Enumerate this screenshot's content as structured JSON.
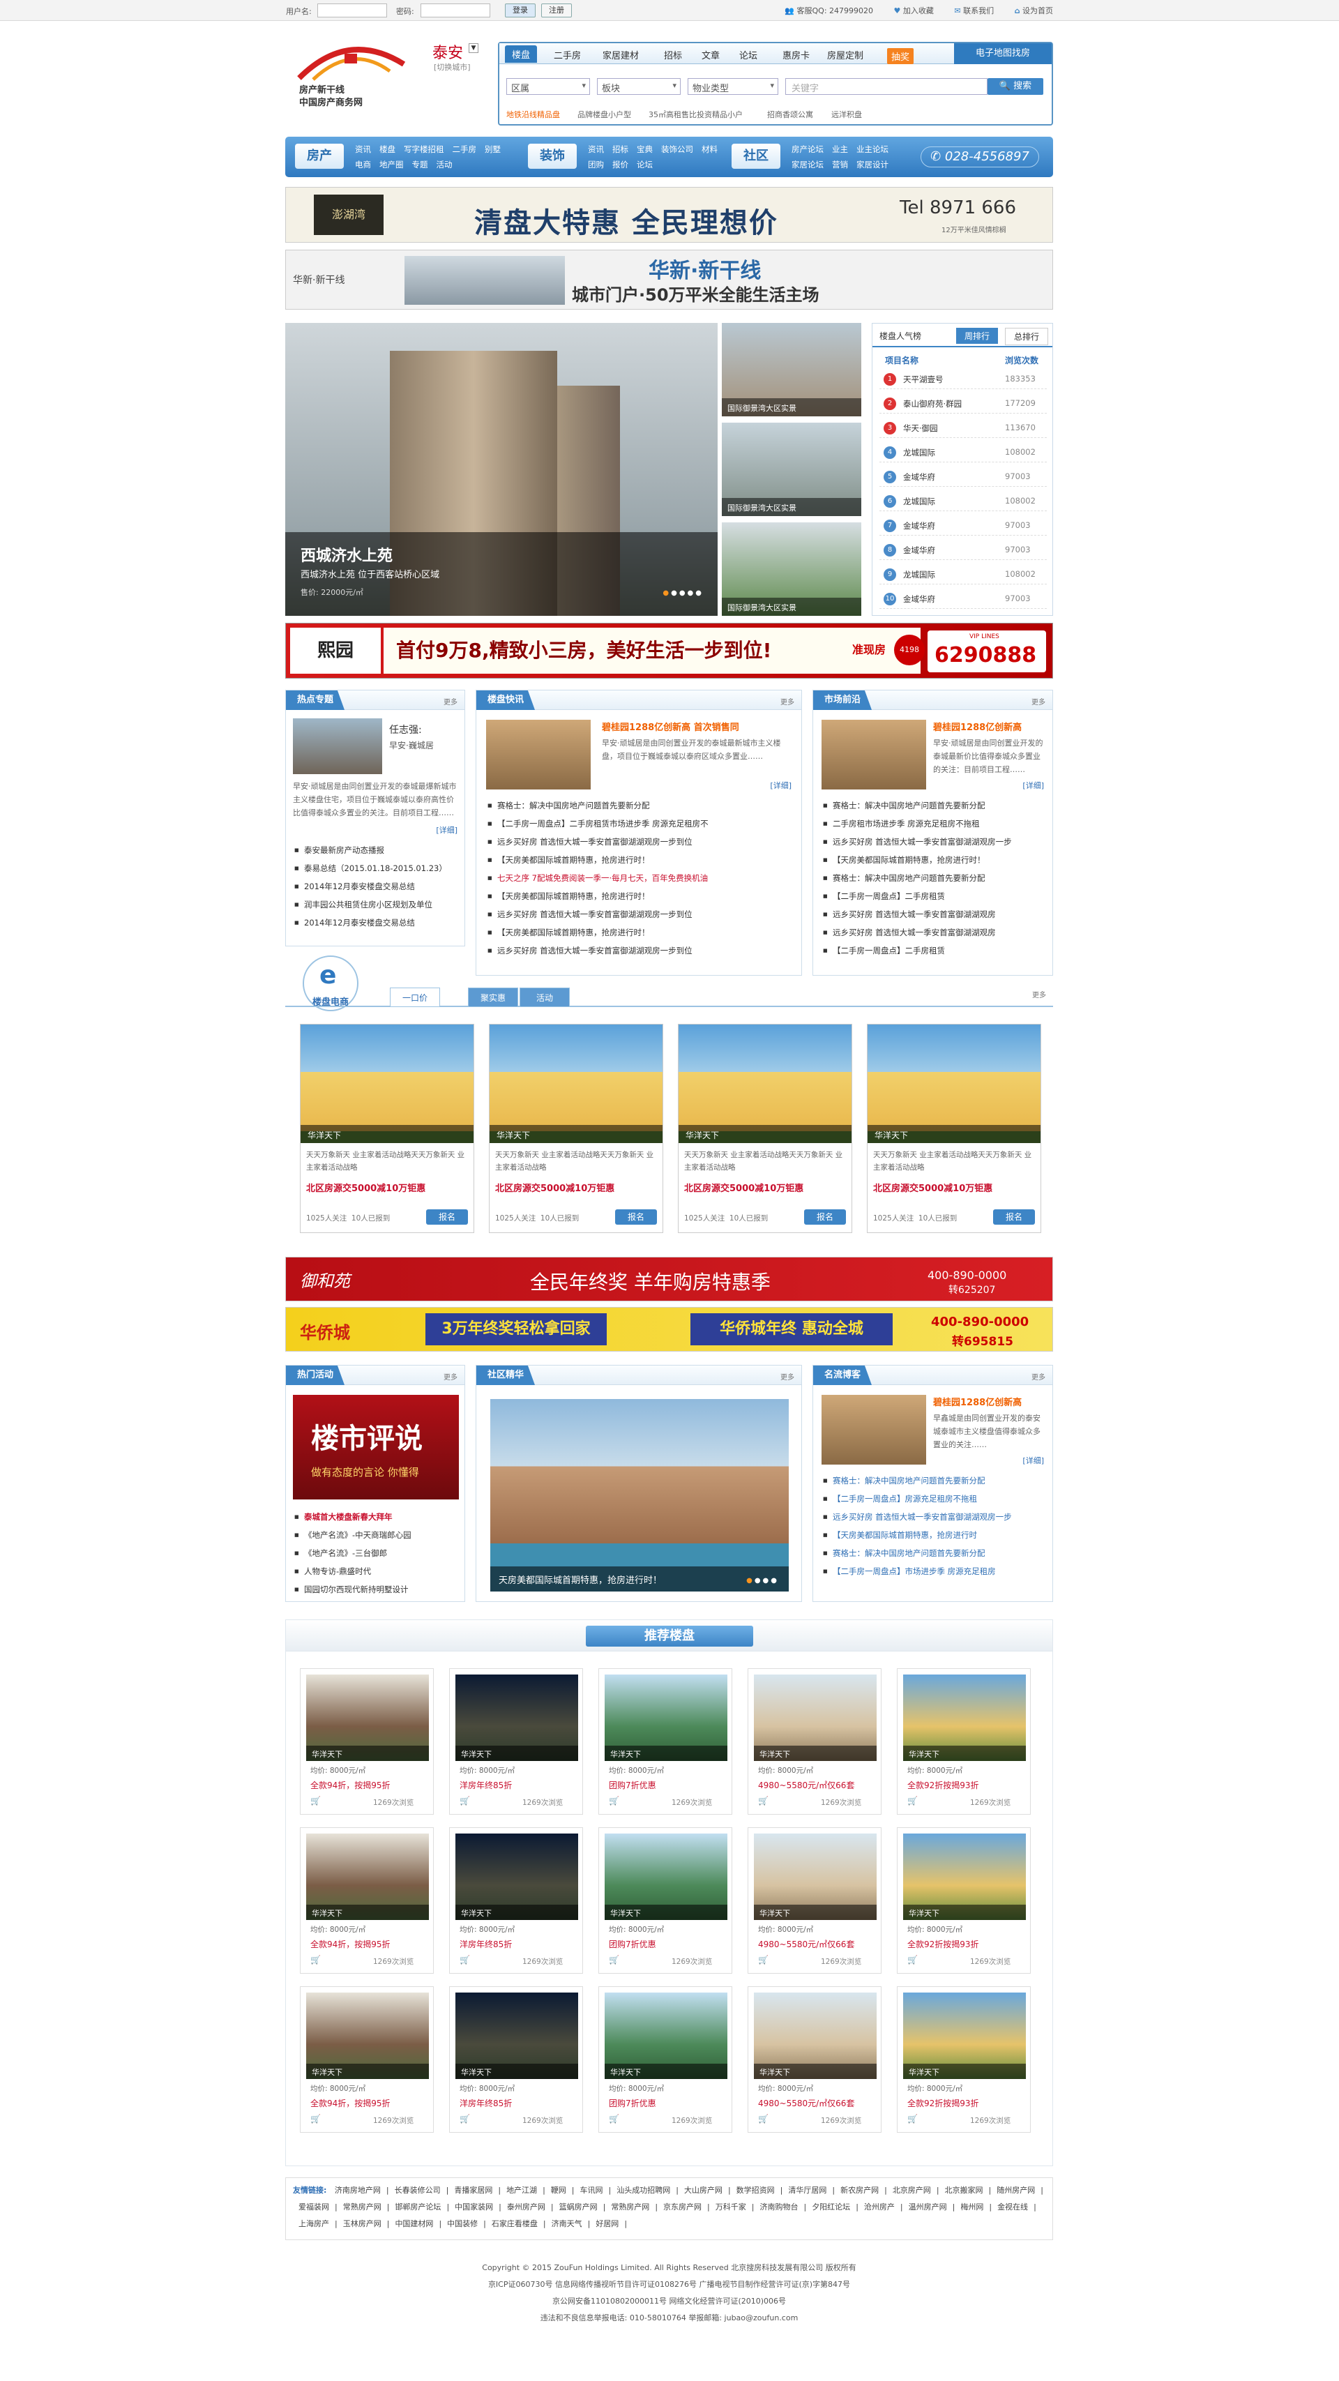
{
  "topbar": {
    "username_label": "用户名:",
    "password_label": "密码:",
    "login": "登录",
    "register": "注册",
    "service": "客服QQ: 247999020",
    "favorite": "加入收藏",
    "contact": "联系我们",
    "homepage": "设为首页"
  },
  "logo": {
    "line1": "房产新干线",
    "line2": "中国房产商务网"
  },
  "city": {
    "name": "泰安",
    "switch": "[切换城市]"
  },
  "search": {
    "tabs": [
      "楼盘",
      "二手房",
      "家居建材",
      "招标",
      "文章",
      "论坛",
      "惠房卡",
      "房屋定制",
      "抽奖"
    ],
    "map_tab": "电子地图找房",
    "selects": [
      "区属",
      "板块",
      "物业类型"
    ],
    "keyword_placeholder": "关键字",
    "button": "搜索",
    "hot": [
      "地铁沿线精品盘",
      "品牌楼盘小户型",
      "35㎡高租售比投资精品小户",
      "招商香颂公寓",
      "远洋积盘"
    ]
  },
  "nav": {
    "groups": [
      {
        "title": "房产",
        "links": [
          "资讯",
          "楼盘",
          "写字楼招租",
          "二手房",
          "别墅",
          "电商",
          "地产圈",
          "专题",
          "活动"
        ]
      },
      {
        "title": "装饰",
        "links": [
          "资讯",
          "招标",
          "宝典",
          "装饰公司",
          "材料",
          "团购",
          "报价",
          "论坛"
        ]
      },
      {
        "title": "社区",
        "links": [
          "房产论坛",
          "业主",
          "业主论坛",
          "家居论坛",
          "营销",
          "家居设计"
        ]
      }
    ],
    "phone": "028-4556897"
  },
  "banners": {
    "b1_brand": "澎湖湾",
    "b1_text": "清盘大特惠  全民理想价",
    "b1_tel": "Tel 8971 666",
    "b1_sub": "12万平米佳风情棕榈",
    "b2_brand": "华新·新干线",
    "b2_title": "华新·新干线",
    "b2_text": "城市门户·50万平米全能生活主场",
    "b3_brand": "熙园",
    "b3_text": "首付9万8,精致小三房，美好生活一步到位!",
    "b3_tag": "准现房",
    "b3_vip": "VIP LINES",
    "b3_phone": "6290888",
    "b3_num": "4198",
    "b4_brand": "御和苑",
    "b4_text": "全民年终奖  羊年购房特惠季",
    "b4_phone": "400-890-0000",
    "b4_ext": "转625207",
    "b5_brand": "华侨城",
    "b5_text": "3万年终奖轻松拿回家",
    "b5_text2": "华侨城年终 惠动全城",
    "b5_phone": "400-890-0000",
    "b5_ext": "转695815"
  },
  "slider": {
    "title": "西城济水上苑",
    "desc": "西城济水上苑 位于西客站桥心区域",
    "price": "售价: 22000元/㎡",
    "thumbs": [
      "国际御景湾大区实景",
      "国际御景湾大区实景",
      "国际御景湾大区实景"
    ]
  },
  "rank": {
    "title": "楼盘人气榜",
    "tabs": [
      "周排行",
      "总排行"
    ],
    "col1": "项目名称",
    "col2": "浏览次数",
    "rows": [
      {
        "name": "天平湖壹号",
        "count": "183353"
      },
      {
        "name": "泰山御府苑·群园",
        "count": "177209"
      },
      {
        "name": "华天·御园",
        "count": "113670"
      },
      {
        "name": "龙城国际",
        "count": "108002"
      },
      {
        "name": "金域华府",
        "count": "97003"
      },
      {
        "name": "龙城国际",
        "count": "108002"
      },
      {
        "name": "金域华府",
        "count": "97003"
      },
      {
        "name": "金域华府",
        "count": "97003"
      },
      {
        "name": "龙城国际",
        "count": "108002"
      },
      {
        "name": "金域华府",
        "count": "97003"
      }
    ]
  },
  "hot_topic": {
    "title": "热点专题",
    "more": "更多",
    "name": "任志强:",
    "sub": "早安·巍城居",
    "desc": "早安·顽城居是由同创置业开发的泰城最爆新城市主义楼盘住宅，项目位于巍城泰城以泰府高性价比值得泰城众多置业的关注。目前项目工程……",
    "detail": "[详细]",
    "items": [
      "泰安最新房产动态播报",
      "泰易总结（2015.01.18-2015.01.23）",
      "2014年12月泰安楼盘交易总结",
      "润丰园公共租赁住房小区规划及单位",
      "2014年12月泰安楼盘交易总结"
    ]
  },
  "news": {
    "title": "楼盘快讯",
    "more": "更多",
    "headline": "碧桂园1288亿创新高 首次销售同",
    "desc": "早安·顽城居是由同创置业开发的泰城最新城市主义楼盘，项目位于巍城泰城以泰府区域众多置业……",
    "detail": "[详细]",
    "items": [
      "赛格士：解决中国房地产问题首先要新分配",
      "【二手房一周盘点】二手房租赁市场进步季 房源充足租房不",
      "远乡买好房 首选恒大城一季安首富御湖湖观房一步到位",
      "【天房美都国际城首期特惠，抢房进行时！",
      "七天之序 7配城免费阅装一季一·每月七天，百年免费换机油",
      "【天房美都国际城首期特惠，抢房进行时！",
      "远乡买好房 首选恒大城一季安首富御湖湖观房一步到位",
      "【天房美都国际城首期特惠，抢房进行时！",
      "远乡买好房 首选恒大城一季安首富御湖湖观房一步到位"
    ]
  },
  "market": {
    "title": "市场前沿",
    "more": "更多",
    "headline": "碧桂园1288亿创新高",
    "desc": "早安·顽城居是由同创置业开发的泰城最新价比值得泰城众多置业的关注：目前项目工程……",
    "detail": "[详细]",
    "items": [
      "赛格士：解决中国房地产问题首先要新分配",
      "二手房租市场进步季 房源充足租房不拖租",
      "远乡买好房 首选恒大城一季安首富御湖湖观房一步",
      "【天房美都国际城首期特惠，抢房进行时！",
      "赛格士：解决中国房地产问题首先要新分配",
      "【二手房一周盘点】二手房租赁",
      "远乡买好房 首选恒大城一季安首富御湖湖观房",
      "远乡买好房 首选恒大城一季安首富御湖湖观房",
      "【二手房一周盘点】二手房租赁"
    ]
  },
  "ecom": {
    "title": "楼盘电商",
    "tabs": [
      "一口价",
      "聚实惠",
      "活动"
    ],
    "more": "更多",
    "cards": [
      {
        "cap": "华洋天下",
        "desc": "天天万象新天  业主家着活动战略天天万象新天  业主家着活动战略",
        "promo": "北区房源交5000减10万钜惠",
        "fans": "1025人关注",
        "joined": "10人已报到",
        "btn": "报名"
      },
      {
        "cap": "华洋天下",
        "desc": "天天万象新天  业主家着活动战略天天万象新天  业主家着活动战略",
        "promo": "北区房源交5000减10万钜惠",
        "fans": "1025人关注",
        "joined": "10人已报到",
        "btn": "报名"
      },
      {
        "cap": "华洋天下",
        "desc": "天天万象新天  业主家着活动战略天天万象新天  业主家着活动战略",
        "promo": "北区房源交5000减10万钜惠",
        "fans": "1025人关注",
        "joined": "10人已报到",
        "btn": "报名"
      },
      {
        "cap": "华洋天下",
        "desc": "天天万象新天  业主家着活动战略天天万象新天  业主家着活动战略",
        "promo": "北区房源交5000减10万钜惠",
        "fans": "1025人关注",
        "joined": "10人已报到",
        "btn": "报名"
      }
    ]
  },
  "activity": {
    "title": "热门活动",
    "more": "更多",
    "img_title": "楼市评说",
    "img_sub": "做有态度的言论 你懂得",
    "items": [
      "泰城首大楼盘新春大拜年",
      "《地产名流》-中天商瑞郎心园",
      "《地产名流》-三台御郎",
      "人物专访-鼎盛时代",
      "国园切尔西现代新持明墅设计"
    ]
  },
  "community": {
    "title": "社区精华",
    "more": "更多",
    "caption": "天房美都国际城首期特惠，抢房进行时！"
  },
  "blog": {
    "title": "名流博客",
    "more": "更多",
    "headline": "碧桂园1288亿创新高",
    "desc": "早鑫城是由同创置业开发的泰安城泰城市主义楼盘值得泰城众多置业的关注……",
    "detail": "[详细]",
    "items": [
      "赛格士：解决中国房地产问题首先要新分配",
      "【二手房一周盘点】房源充足租房不拖租",
      "远乡买好房 首选恒大城一季安首富御湖湖观房一步",
      "【天房美都国际城首期特惠，抢房进行时",
      "赛格士：解决中国房地产问题首先要新分配",
      "【二手房一周盘点】市场进步季 房源充足租房"
    ]
  },
  "recommend": {
    "title": "推荐楼盘",
    "cards": [
      {
        "cap": "华洋天下",
        "price": "均价: 8000元/㎡",
        "promo": "全款94折，按揭95折",
        "views": "1269次浏览"
      },
      {
        "cap": "华洋天下",
        "price": "均价: 8000元/㎡",
        "promo": "洋房年终85折",
        "views": "1269次浏览"
      },
      {
        "cap": "华洋天下",
        "price": "均价: 8000元/㎡",
        "promo": "团购7折优惠",
        "views": "1269次浏览"
      },
      {
        "cap": "华洋天下",
        "price": "均价: 8000元/㎡",
        "promo": "4980~5580元/㎡仅66套",
        "views": "1269次浏览"
      },
      {
        "cap": "华洋天下",
        "price": "均价: 8000元/㎡",
        "promo": "全款92折按揭93折",
        "views": "1269次浏览"
      },
      {
        "cap": "华洋天下",
        "price": "均价: 8000元/㎡",
        "promo": "全款94折，按揭95折",
        "views": "1269次浏览"
      },
      {
        "cap": "华洋天下",
        "price": "均价: 8000元/㎡",
        "promo": "洋房年终85折",
        "views": "1269次浏览"
      },
      {
        "cap": "华洋天下",
        "price": "均价: 8000元/㎡",
        "promo": "团购7折优惠",
        "views": "1269次浏览"
      },
      {
        "cap": "华洋天下",
        "price": "均价: 8000元/㎡",
        "promo": "4980~5580元/㎡仅66套",
        "views": "1269次浏览"
      },
      {
        "cap": "华洋天下",
        "price": "均价: 8000元/㎡",
        "promo": "全款92折按揭93折",
        "views": "1269次浏览"
      },
      {
        "cap": "华洋天下",
        "price": "均价: 8000元/㎡",
        "promo": "全款94折，按揭95折",
        "views": "1269次浏览"
      },
      {
        "cap": "华洋天下",
        "price": "均价: 8000元/㎡",
        "promo": "洋房年终85折",
        "views": "1269次浏览"
      },
      {
        "cap": "华洋天下",
        "price": "均价: 8000元/㎡",
        "promo": "团购7折优惠",
        "views": "1269次浏览"
      },
      {
        "cap": "华洋天下",
        "price": "均价: 8000元/㎡",
        "promo": "4980~5580元/㎡仅66套",
        "views": "1269次浏览"
      },
      {
        "cap": "华洋天下",
        "price": "均价: 8000元/㎡",
        "promo": "全款92折按揭93折",
        "views": "1269次浏览"
      }
    ]
  },
  "friends": {
    "title": "友情链接:",
    "links": [
      "济南房地产网",
      "长春装修公司",
      "青播家居网",
      "地产江湖",
      "鞭网",
      "车讯网",
      "汕头成功招聘网",
      "大山房产网",
      "数学招资网",
      "清华厅居网",
      "新农房产网",
      "北京房产网",
      "北京搬家网",
      "随州房产网",
      "爱福装网",
      "常熟房产网",
      "邯郸房产论坛",
      "中国家装网",
      "泰州房产网",
      "篮蜗房产网",
      "常熟房产网",
      "京东房产网",
      "万科千家",
      "济南购物台",
      "夕阳红论坛",
      "沧州房产",
      "温州房产网",
      "梅州网",
      "金视在线",
      "上海房产",
      "玉林房产网",
      "中国建材网",
      "中国装修",
      "石家庄看楼盘",
      "济南天气",
      "好居网"
    ]
  },
  "footer": {
    "line1": "Copyright © 2015 ZouFun Holdings Limited. All Rights Reserved 北京搜房科技发展有限公司 版权所有",
    "line2": "京ICP证060730号 信息网络传播视听节目许可证0108276号 广播电视节目制作经营许可证(京)字第847号",
    "line3": "京公网安备11010802000011号 网络文化经营许可证(2010)006号",
    "line4": "违法和不良信息举报电话: 010-58010764 举报邮箱: jubao@zoufun.com"
  }
}
